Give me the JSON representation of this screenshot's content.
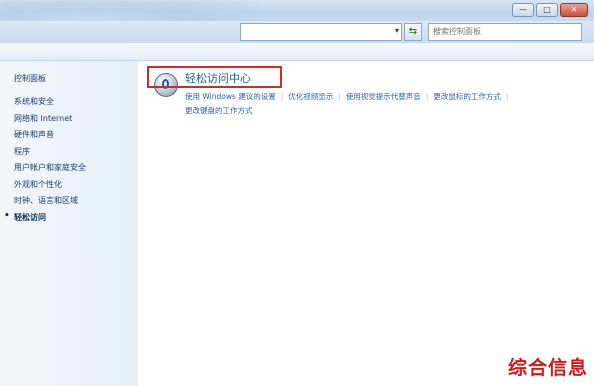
{
  "window": {
    "buttons": {
      "minimize": "—",
      "maximize": "□",
      "close": "✕"
    }
  },
  "address": {
    "search_placeholder": "搜索控制面板",
    "refresh_icon": "refresh-icon",
    "dropdown_icon": "chevron-down-icon"
  },
  "sidebar": {
    "home": "控制面板",
    "items": [
      {
        "label": "系统和安全"
      },
      {
        "label": "网络和 Internet"
      },
      {
        "label": "硬件和声音"
      },
      {
        "label": "程序"
      },
      {
        "label": "用户帐户和家庭安全"
      },
      {
        "label": "外观和个性化"
      },
      {
        "label": "时钟、语言和区域"
      },
      {
        "label": "轻松访问"
      }
    ],
    "current_index": 7
  },
  "main": {
    "category_title": "轻松访问中心",
    "links": [
      "使用 Windows 建议的设置",
      "优化视频显示",
      "使用视觉提示代替声音",
      "更改鼠标的工作方式"
    ],
    "links_row2": [
      "更改键盘的工作方式"
    ]
  },
  "watermark": "综合信息",
  "colors": {
    "highlight_border": "#d42a2a",
    "link": "#2a63b8",
    "watermark": "#d4191c"
  }
}
